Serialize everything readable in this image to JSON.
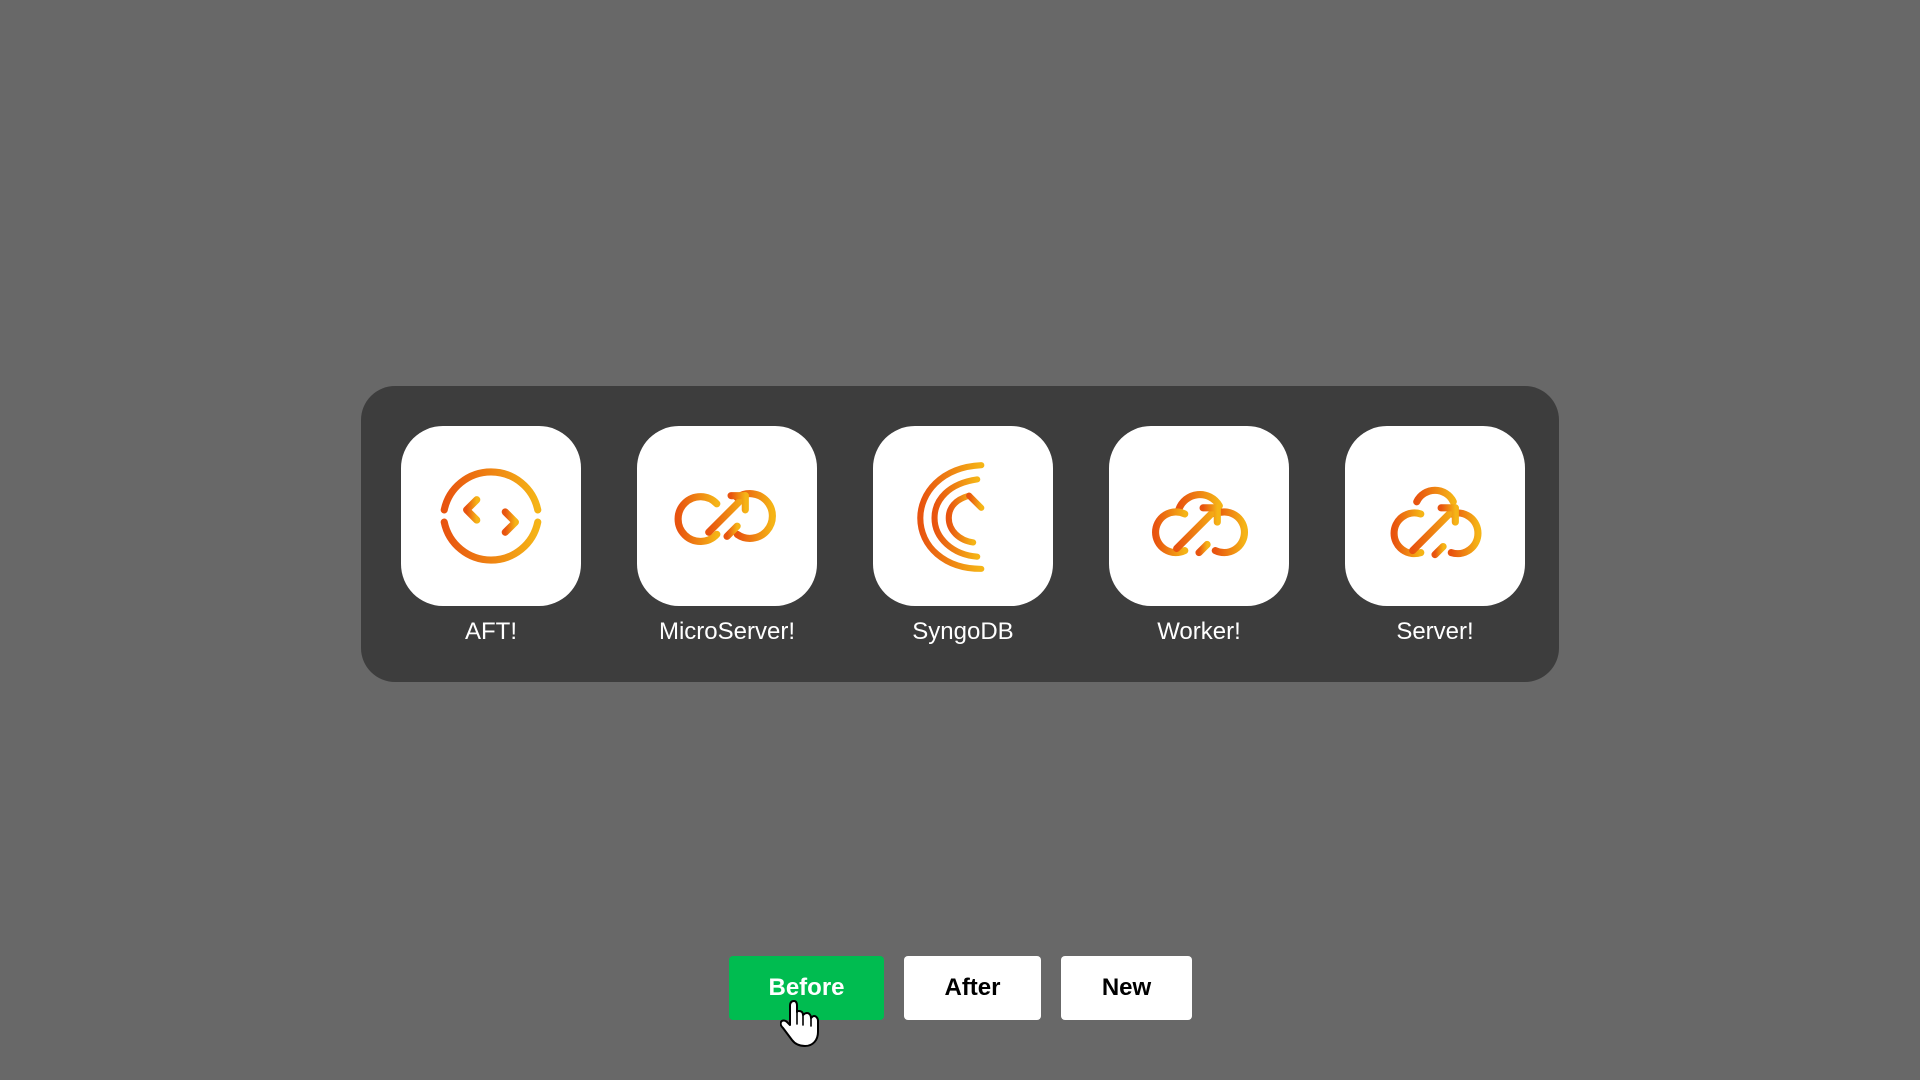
{
  "colors": {
    "background": "#686868",
    "dock": "#3d3d3d",
    "tile": "#ffffff",
    "icon_gradient_start": "#e8530f",
    "icon_gradient_end": "#f5b416",
    "before_button": "#00bc50"
  },
  "dock": {
    "apps": [
      {
        "label": "AFT!",
        "icon": "transfer-arrows-icon"
      },
      {
        "label": "MicroServer!",
        "icon": "infinity-arrow-icon"
      },
      {
        "label": "SyngoDB",
        "icon": "crescent-c-icon"
      },
      {
        "label": "Worker!",
        "icon": "cloud-arrow-icon"
      },
      {
        "label": "Server!",
        "icon": "cloud-arrow-icon"
      }
    ]
  },
  "buttons": {
    "before": "Before",
    "after": "After",
    "new": "New",
    "selected": "Before"
  },
  "pointer": {
    "icon": "hand-pointer-icon"
  }
}
